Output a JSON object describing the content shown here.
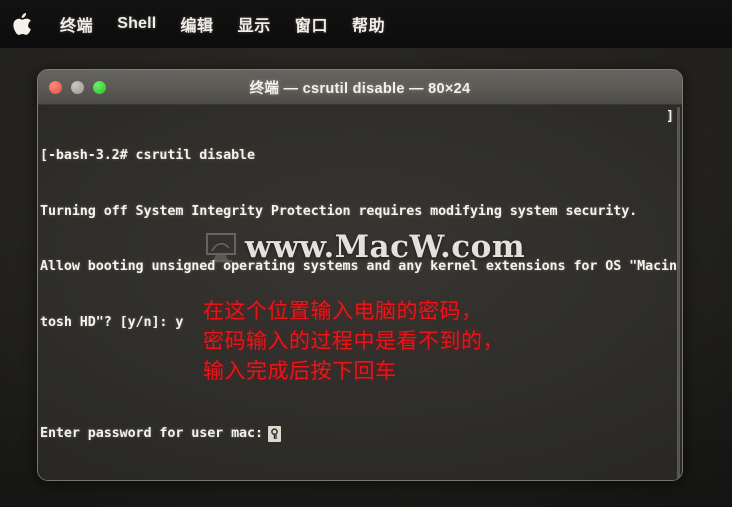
{
  "menubar": {
    "apple_icon": "apple-logo-icon",
    "items": [
      {
        "label": "终端",
        "name": "menu-terminal"
      },
      {
        "label": "Shell",
        "name": "menu-shell"
      },
      {
        "label": "编辑",
        "name": "menu-edit"
      },
      {
        "label": "显示",
        "name": "menu-view"
      },
      {
        "label": "窗口",
        "name": "menu-window"
      },
      {
        "label": "帮助",
        "name": "menu-help"
      }
    ]
  },
  "window": {
    "title": "终端 — csrutil disable — 80×24",
    "traffic_lights": {
      "close": "close-button",
      "minimize": "minimize-button",
      "zoom": "zoom-button"
    }
  },
  "terminal": {
    "lines": [
      "[-bash-3.2# csrutil disable",
      "Turning off System Integrity Protection requires modifying system security.",
      "Allow booting unsigned operating systems and any kernel extensions for OS \"Macin",
      "tosh HD\"? [y/n]: y"
    ],
    "overflow_bracket": "]",
    "password_prompt": "Enter password for user mac:",
    "cursor_icon": "key-icon"
  },
  "watermark": {
    "text": "www.MacW.com",
    "logo_icon": "monitor-logo-icon"
  },
  "annotation": {
    "color": "#e8151b",
    "lines": [
      "在这个位置输入电脑的密码，",
      "密码输入的过程中是看不到的，",
      "输入完成后按下回车"
    ]
  },
  "colors": {
    "desktop_bg": "#1b1a18",
    "titlebar": "#5d5b56",
    "terminal_bg": "#2c2b28",
    "terminal_fg": "#f6f3ea",
    "annotation_red": "#e8151b",
    "light_close": "#e4503f",
    "light_minimize": "#9d9b91",
    "light_zoom": "#28c028"
  }
}
